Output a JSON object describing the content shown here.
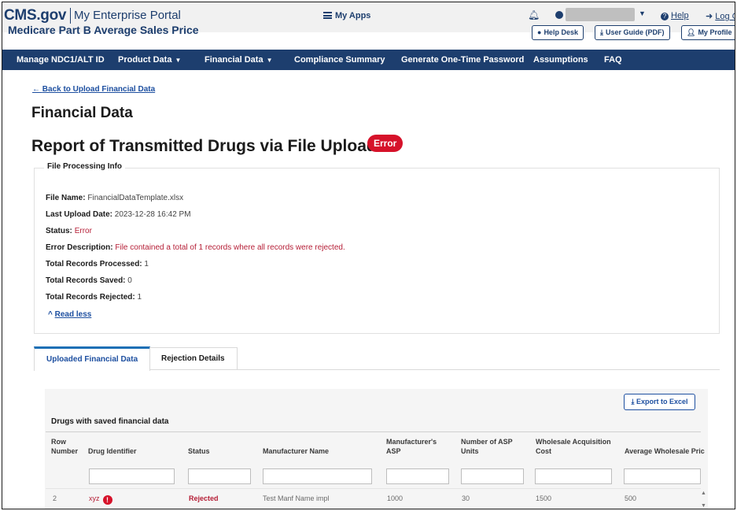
{
  "header": {
    "logo": "CMS.gov",
    "portal": "My Enterprise Portal",
    "app_title": "Medicare Part B Average Sales Price",
    "my_apps": "My Apps",
    "help": "Help",
    "logout": "Log Out",
    "help_desk": "Help Desk",
    "user_guide": "User Guide (PDF)",
    "my_profile": "My Profile"
  },
  "nav": {
    "items": [
      "Manage NDC1/ALT ID",
      "Product Data",
      "Financial Data",
      "Compliance Summary",
      "Generate One-Time Password",
      "Assumptions",
      "FAQ"
    ]
  },
  "page": {
    "back_link": "Back to Upload Financial Data",
    "title": "Financial Data",
    "subtitle": "Report of Transmitted Drugs via File Upload",
    "status_badge": "Error"
  },
  "file_info": {
    "legend": "File Processing Info",
    "rows": [
      {
        "key": "File Name:",
        "value": "FinancialDataTemplate.xlsx"
      },
      {
        "key": "Last Upload Date:",
        "value": "2023-12-28 16:42 PM"
      },
      {
        "key": "Status:",
        "value": "Error"
      },
      {
        "key": "Error Description:",
        "value": "File contained a total of 1 records where all records were rejected."
      },
      {
        "key": "Total Records Processed:",
        "value": "1"
      },
      {
        "key": "Total Records Saved:",
        "value": "0"
      },
      {
        "key": "Total Records Rejected:",
        "value": "1"
      }
    ],
    "read_less": "Read less"
  },
  "tabs": [
    "Uploaded Financial Data",
    "Rejection Details"
  ],
  "table": {
    "export_label": "Export to Excel",
    "title": "Drugs with saved financial data",
    "columns": [
      [
        "Row",
        "Number"
      ],
      [
        "",
        "Drug Identifier"
      ],
      [
        "",
        "Status"
      ],
      [
        "",
        "Manufacturer Name"
      ],
      [
        "Manufacturer's",
        "ASP"
      ],
      [
        "Number of ASP",
        "Units"
      ],
      [
        "Wholesale Acquisition",
        "Cost"
      ],
      [
        "",
        "Average Wholesale Pric"
      ]
    ],
    "rows": [
      [
        "2",
        "xyz",
        "Rejected",
        "Test Manf Name impl",
        "1000",
        "30",
        "1500",
        "500"
      ]
    ]
  }
}
